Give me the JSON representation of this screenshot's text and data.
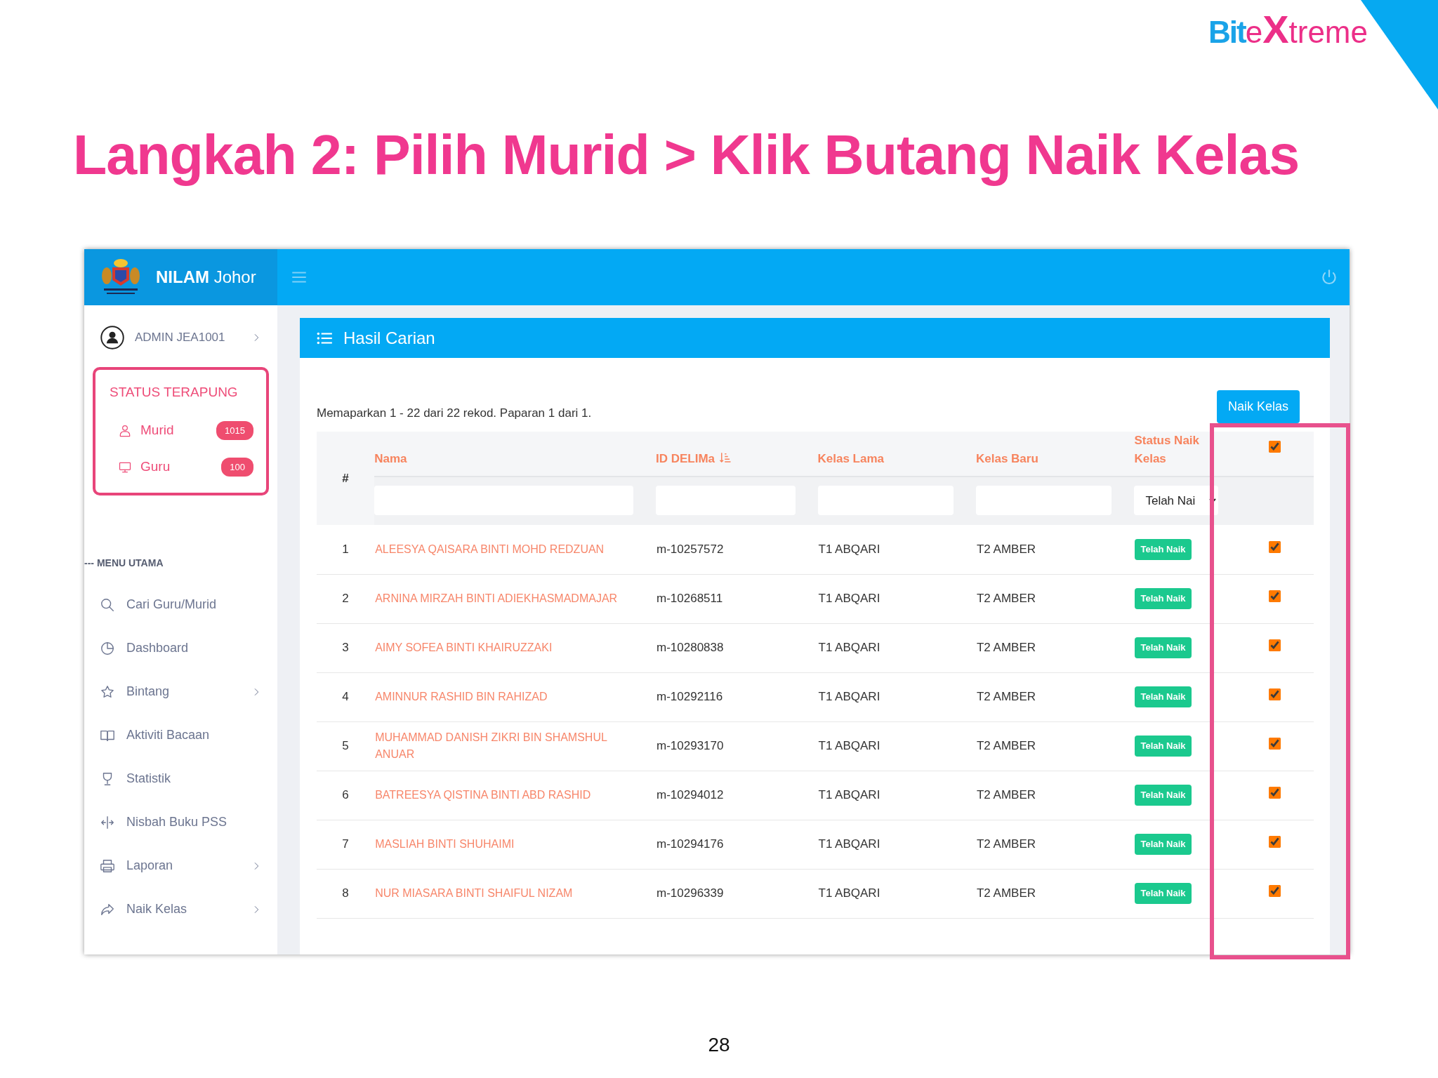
{
  "slide": {
    "title": "Langkah 2: Pilih Murid > Klik Butang Naik Kelas",
    "logo": [
      "Bit",
      "e",
      "X",
      "treme"
    ],
    "page_number": "28"
  },
  "app": {
    "brand": {
      "name": "NILAM",
      "region": "Johor"
    },
    "user": "ADMIN JEA1001",
    "status_panel": {
      "title": "STATUS TERAPUNG",
      "items": [
        {
          "label": "Murid",
          "count": "1015",
          "kind": "person"
        },
        {
          "label": "Guru",
          "count": "100",
          "kind": "monitor"
        }
      ]
    },
    "menu_heading": "--- MENU UTAMA",
    "menu": [
      {
        "label": "Cari Guru/Murid",
        "kind": "search",
        "has_submenu": false
      },
      {
        "label": "Dashboard",
        "kind": "pie",
        "has_submenu": false
      },
      {
        "label": "Bintang",
        "kind": "star",
        "has_submenu": true
      },
      {
        "label": "Aktiviti Bacaan",
        "kind": "book",
        "has_submenu": false
      },
      {
        "label": "Statistik",
        "kind": "trophy",
        "has_submenu": false
      },
      {
        "label": "Nisbah Buku PSS",
        "kind": "split",
        "has_submenu": false
      },
      {
        "label": "Laporan",
        "kind": "printer",
        "has_submenu": true
      },
      {
        "label": "Naik Kelas",
        "kind": "share",
        "has_submenu": true
      }
    ],
    "card": {
      "title": "Hasil Carian",
      "summary": "Memaparkan 1 - 22 dari 22 rekod. Paparan 1 dari 1.",
      "action": "Naik Kelas",
      "columns": [
        {
          "label": "#",
          "sorted": false,
          "kind": "index"
        },
        {
          "label": "Nama",
          "sorted": false,
          "kind": "text"
        },
        {
          "label": "ID DELIMa",
          "sorted": true,
          "kind": "text"
        },
        {
          "label": "Kelas Lama",
          "sorted": false,
          "kind": "text"
        },
        {
          "label": "Kelas Baru",
          "sorted": false,
          "kind": "text"
        },
        {
          "label": "Status Naik Kelas",
          "sorted": false,
          "kind": "select"
        }
      ],
      "status_filter": "Telah Nai",
      "select_all_checked": true,
      "rows": [
        {
          "no": "1",
          "name": "ALEESYA QAISARA BINTI MOHD REDZUAN",
          "id": "m-10257572",
          "old_class": "T1 ABQARI",
          "new_class": "T2 AMBER",
          "status": "Telah Naik",
          "checked": true
        },
        {
          "no": "2",
          "name": "ARNINA MIRZAH BINTI ADIEKHASMADMAJAR",
          "id": "m-10268511",
          "old_class": "T1 ABQARI",
          "new_class": "T2 AMBER",
          "status": "Telah Naik",
          "checked": true
        },
        {
          "no": "3",
          "name": "AIMY SOFEA BINTI KHAIRUZZAKI",
          "id": "m-10280838",
          "old_class": "T1 ABQARI",
          "new_class": "T2 AMBER",
          "status": "Telah Naik",
          "checked": true
        },
        {
          "no": "4",
          "name": "AMINNUR RASHID BIN RAHIZAD",
          "id": "m-10292116",
          "old_class": "T1 ABQARI",
          "new_class": "T2 AMBER",
          "status": "Telah Naik",
          "checked": true
        },
        {
          "no": "5",
          "name": "MUHAMMAD DANISH ZIKRI BIN SHAMSHUL ANUAR",
          "id": "m-10293170",
          "old_class": "T1 ABQARI",
          "new_class": "T2 AMBER",
          "status": "Telah Naik",
          "checked": true
        },
        {
          "no": "6",
          "name": "BATREESYA QISTINA BINTI ABD RASHID",
          "id": "m-10294012",
          "old_class": "T1 ABQARI",
          "new_class": "T2 AMBER",
          "status": "Telah Naik",
          "checked": true
        },
        {
          "no": "7",
          "name": "MASLIAH BINTI SHUHAIMI",
          "id": "m-10294176",
          "old_class": "T1 ABQARI",
          "new_class": "T2 AMBER",
          "status": "Telah Naik",
          "checked": true
        },
        {
          "no": "8",
          "name": "NUR MIASARA BINTI SHAIFUL NIZAM",
          "id": "m-10296339",
          "old_class": "T1 ABQARI",
          "new_class": "T2 AMBER",
          "status": "Telah Naik",
          "checked": true
        }
      ]
    }
  }
}
